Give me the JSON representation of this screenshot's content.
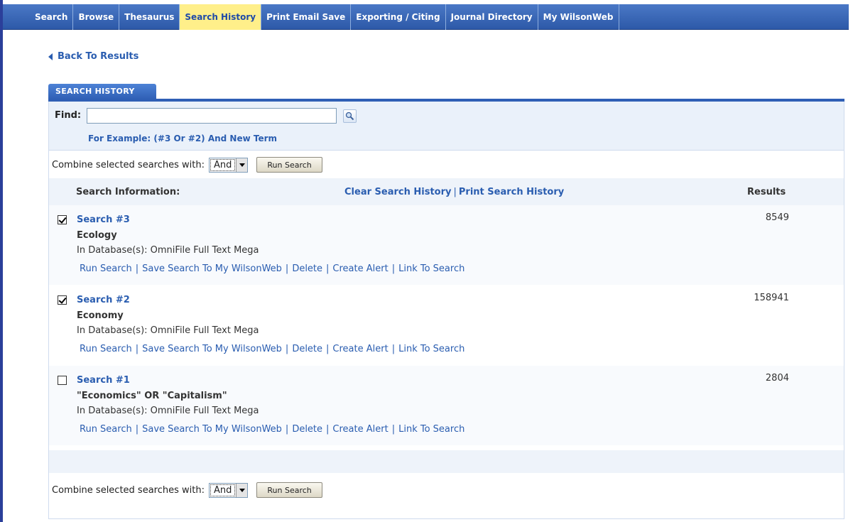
{
  "nav": {
    "tabs": [
      {
        "label": "Search"
      },
      {
        "label": "Browse"
      },
      {
        "label": "Thesaurus"
      },
      {
        "label": "Search History",
        "active": true
      },
      {
        "label": "Print Email Save"
      },
      {
        "label": "Exporting / Citing"
      },
      {
        "label": "Journal Directory"
      },
      {
        "label": "My WilsonWeb"
      }
    ]
  },
  "back_link": "Back To Results",
  "panel": {
    "tab_title": "SEARCH HISTORY",
    "find_label": "Find:",
    "find_value": "",
    "find_example": "For Example: (#3 Or #2) And New Term"
  },
  "combine": {
    "label": "Combine selected searches with:",
    "operator": "And",
    "button": "Run Search"
  },
  "header": {
    "info": "Search Information:",
    "clear": "Clear Search History",
    "sep": "|",
    "print": "Print Search History",
    "results": "Results"
  },
  "searches": [
    {
      "title": "Search #3",
      "term": "Ecology",
      "database": "In Database(s): OmniFile Full Text Mega",
      "results": "8549",
      "checked": true
    },
    {
      "title": "Search #2",
      "term": "Economy",
      "database": "In Database(s): OmniFile Full Text Mega",
      "results": "158941",
      "checked": true
    },
    {
      "title": "Search #1",
      "term": "\"Economics\" OR \"Capitalism\"",
      "database": "In Database(s): OmniFile Full Text Mega",
      "results": "2804",
      "checked": false
    }
  ],
  "actions": {
    "run": "Run Search",
    "save": "Save Search To My WilsonWeb",
    "delete": "Delete",
    "alert": "Create Alert",
    "link": "Link To Search",
    "sep": "|"
  },
  "colors": {
    "nav_bg": "#2d59a8",
    "active_tab": "#ffef8a",
    "link": "#2a5db0"
  }
}
